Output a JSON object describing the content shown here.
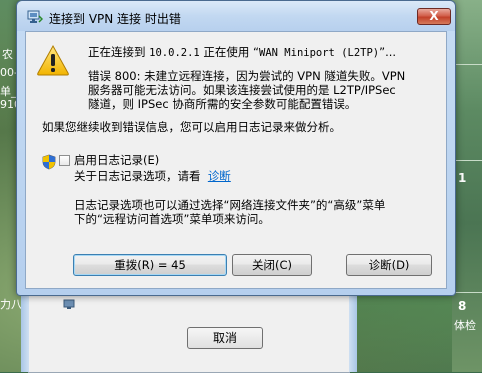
{
  "background": {
    "left_texts": [
      "农",
      "00-",
      "单_",
      "910",
      "力八"
    ],
    "right_numbers": [
      "1",
      "8"
    ],
    "right_label": "体检",
    "under_window_button": "取消"
  },
  "dialog": {
    "title": "连接到 VPN 连接 时出错",
    "close_label": "X",
    "message_line1_a": "正在连接到 ",
    "message_line1_b": "10.0.2.1",
    "message_line1_c": " 正在使用 “",
    "message_line1_d": "WAN Miniport (L2TP)",
    "message_line1_e": "”...",
    "error_line1": "错误 800: 未建立远程连接，因为尝试的 VPN 隧道失败。VPN",
    "error_line2": "服务器可能无法访问。如果该连接尝试使用的是 L2TP/IPSec",
    "error_line3": "隧道，则 IPSec 协商所需的安全参数可能配置错误。",
    "log_hint": "如果您继续收到错误信息，您可以启用日志记录来做分析。",
    "enable_log_label": "启用日志记录(E)",
    "log_options_text": "关于日志记录选项，请看",
    "diagnose_link": "诊断",
    "options_line1": "日志记录选项也可以通过选择“网络连接文件夹”的“高级”菜单",
    "options_line2": "下的“远程访问首选项”菜单项来访问。",
    "buttons": {
      "redial": "重拨(R) = 45",
      "close": "关闭(C)",
      "diagnose": "诊断(D)"
    }
  },
  "colors": {
    "link": "#0066cc",
    "close_button": "#c2412a",
    "title_bar": "#c2d8f1"
  }
}
